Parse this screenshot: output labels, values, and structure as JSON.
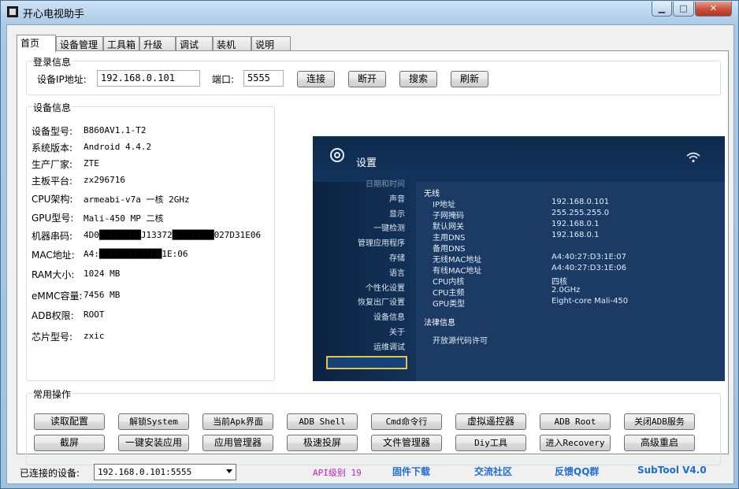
{
  "window": {
    "title": "开心电视助手",
    "minimize": "▁",
    "maximize": "□",
    "close": "✕"
  },
  "tabs": [
    "首页",
    "设备管理",
    "工具箱",
    "升级",
    "调试",
    "装机",
    "说明"
  ],
  "login": {
    "group_title": "登录信息",
    "ip_label": "设备IP地址:",
    "ip_value": "192.168.0.101",
    "port_label": "端口:",
    "port_value": "5555",
    "buttons": [
      "连接",
      "断开",
      "搜索",
      "刷新"
    ]
  },
  "device_info": {
    "group_title": "设备信息",
    "rows": [
      {
        "label": "设备型号:",
        "value": "B860AV1.1-T2"
      },
      {
        "label": "系统版本:",
        "value": "Android 4.4.2"
      },
      {
        "label": "生产厂家:",
        "value": "ZTE"
      },
      {
        "label": "主板平台:",
        "value": "zx296716"
      },
      {
        "label": "CPU架构:",
        "value": "armeabi-v7a 一核 2GHz"
      },
      {
        "label": "GPU型号:",
        "value": "Mali-450 MP 二核"
      },
      {
        "label": "机器串码:",
        "value": "4D0████████J13372████████027D31E06"
      },
      {
        "label": "MAC地址:",
        "value": "A4:████████████1E:06"
      },
      {
        "label": "RAM大小:",
        "value": "1024 MB"
      },
      {
        "label": "eMMC容量:",
        "value": "7456 MB"
      },
      {
        "label": "ADB权限:",
        "value": "ROOT"
      },
      {
        "label": "芯片型号:",
        "value": "zxic"
      }
    ]
  },
  "tv_screen": {
    "title": "设置",
    "menu": [
      "日期和时间",
      "声音",
      "显示",
      "一键检测",
      "管理应用程序",
      "存储",
      "语言",
      "个性化设置",
      "恢复出厂设置",
      "设备信息",
      "关于",
      "运维调试"
    ],
    "section_wireless": "无线",
    "rows": [
      {
        "k": "IP地址",
        "v": "192.168.0.101"
      },
      {
        "k": "子网掩码",
        "v": "255.255.255.0"
      },
      {
        "k": "默认网关",
        "v": "192.168.0.1"
      },
      {
        "k": "主用DNS",
        "v": "192.168.0.1"
      },
      {
        "k": "备用DNS",
        "v": ""
      },
      {
        "k": "无线MAC地址",
        "v": "A4:40:27:D3:1E:07"
      },
      {
        "k": "有线MAC地址",
        "v": "A4:40:27:D3:1E:06"
      },
      {
        "k": "CPU内核",
        "v": "四核"
      },
      {
        "k": "CPU主频",
        "v": "2.0GHz"
      },
      {
        "k": "GPU类型",
        "v": "Eight-core Mali-450"
      }
    ],
    "section_legal": "法律信息",
    "open_source": "开放源代码许可"
  },
  "common_ops": {
    "group_title": "常用操作",
    "row1": [
      "读取配置",
      "解锁System",
      "当前Apk界面",
      "ADB Shell",
      "Cmd命令行",
      "虚拟遥控器",
      "ADB  Root",
      "关闭ADB服务"
    ],
    "row2": [
      "截屏",
      "一键安装应用",
      "应用管理器",
      "极速投屏",
      "文件管理器",
      "Diy工具",
      "进入Recovery",
      "高级重启"
    ]
  },
  "status_bar": {
    "connected_label": "已连接的设备:",
    "connected_value": "192.168.0.101:5555",
    "api_level": "API级别 19",
    "firmware": "固件下载",
    "community": "交流社区",
    "feedback": "反馈QQ群",
    "version": "SubTool V4.0"
  },
  "colors": {
    "api": "#c020c0",
    "link": "#1e6bd6",
    "tv_bg": "#0e2a4d",
    "tv_select": "#e5c24a"
  }
}
